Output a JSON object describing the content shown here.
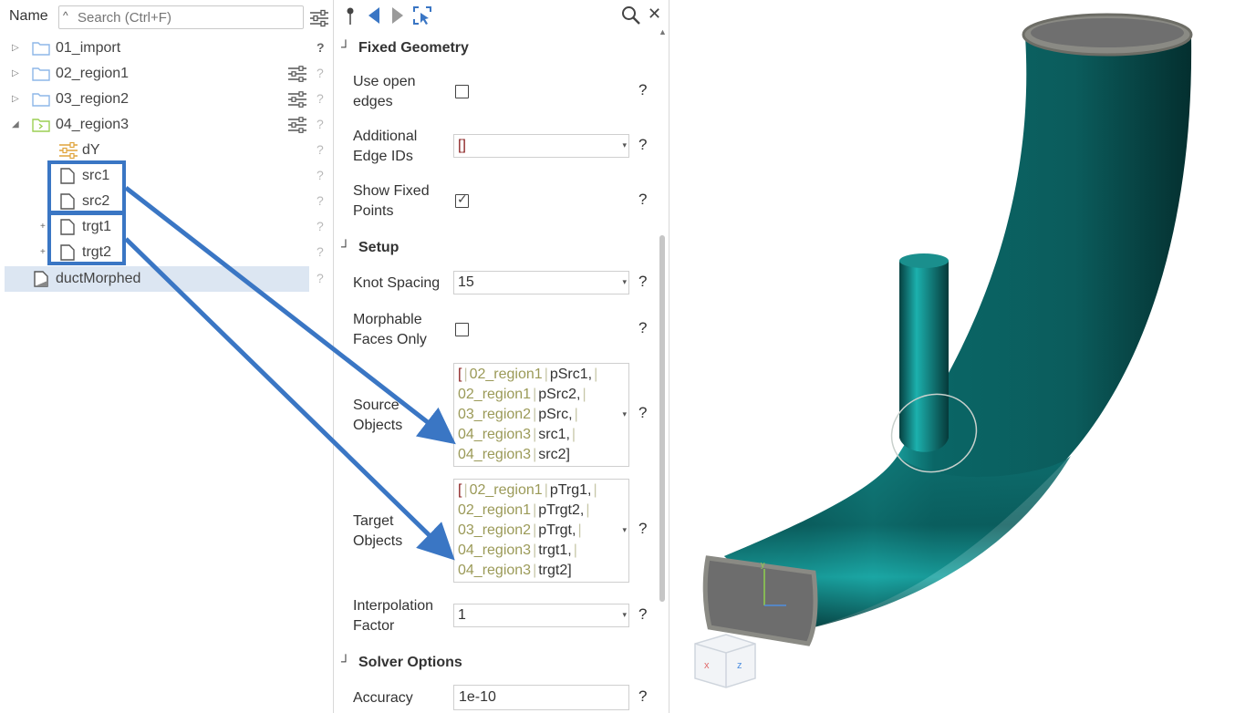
{
  "tree": {
    "header_label": "Name",
    "search_placeholder": "Search (Ctrl+F)",
    "items": [
      {
        "label": "01_import"
      },
      {
        "label": "02_region1"
      },
      {
        "label": "03_region2"
      },
      {
        "label": "04_region3"
      },
      {
        "label": "dY"
      },
      {
        "label": "src1"
      },
      {
        "label": "src2"
      },
      {
        "label": "trgt1"
      },
      {
        "label": "trgt2"
      },
      {
        "label": "ductMorphed"
      }
    ],
    "help_glyph": "?",
    "expand_glyph": "▷",
    "collapse_glyph": "◢",
    "plus_glyph": "+"
  },
  "props": {
    "sections": {
      "fixed_geometry": "Fixed Geometry",
      "setup": "Setup",
      "solver_options": "Solver Options"
    },
    "collapse_glyph": "┘",
    "help_glyph": "?",
    "fields": {
      "use_open_edges": {
        "label_1": "Use open",
        "label_2": "edges",
        "checked": false
      },
      "additional_edge_ids": {
        "label_1": "Additional",
        "label_2": "Edge IDs",
        "value": "[]"
      },
      "show_fixed_points": {
        "label_1": "Show Fixed",
        "label_2": "Points",
        "checked": true
      },
      "knot_spacing": {
        "label": "Knot Spacing",
        "value": "15"
      },
      "morphable_faces_only": {
        "label_1": "Morphable",
        "label_2": "Faces Only",
        "checked": false
      },
      "source_objects": {
        "label_1": "Source",
        "label_2": "Objects",
        "lines": [
          {
            "open": "[",
            "region": "02_region1",
            "name": "pSrc1,"
          },
          {
            "open": "",
            "region": "02_region1",
            "name": "pSrc2,"
          },
          {
            "open": "",
            "region": "03_region2",
            "name": "pSrc,"
          },
          {
            "open": "",
            "region": "04_region3",
            "name": "src1,"
          },
          {
            "open": "",
            "region": "04_region3",
            "name": "src2]"
          }
        ]
      },
      "target_objects": {
        "label_1": "Target",
        "label_2": "Objects",
        "lines": [
          {
            "open": "[",
            "region": "02_region1",
            "name": "pTrg1,"
          },
          {
            "open": "",
            "region": "02_region1",
            "name": "pTrgt2,"
          },
          {
            "open": "",
            "region": "03_region2",
            "name": "pTrgt,"
          },
          {
            "open": "",
            "region": "04_region3",
            "name": "trgt1,"
          },
          {
            "open": "",
            "region": "04_region3",
            "name": "trgt2]"
          }
        ]
      },
      "interpolation_factor": {
        "label_1": "Interpolation",
        "label_2": "Factor",
        "value": "1"
      },
      "accuracy": {
        "label": "Accuracy",
        "value": "1e-10"
      }
    }
  },
  "toolbar": {
    "pin_icon": "pin-icon",
    "back_icon": "back-arrow-icon",
    "forward_icon": "forward-arrow-icon",
    "select_icon": "select-icon",
    "search_icon": "search-icon",
    "close_glyph": "✕"
  },
  "viewport": {
    "orientation_cube": {
      "x_label": "x",
      "z_label": "z",
      "y_label": "y"
    }
  },
  "colors": {
    "accent_blue": "#3a76c4",
    "duct_teal": "#0e6b6b",
    "selection_bg": "#dce6f2",
    "folder_blue": "#8db7e8",
    "folder_green": "#9ccf54"
  }
}
